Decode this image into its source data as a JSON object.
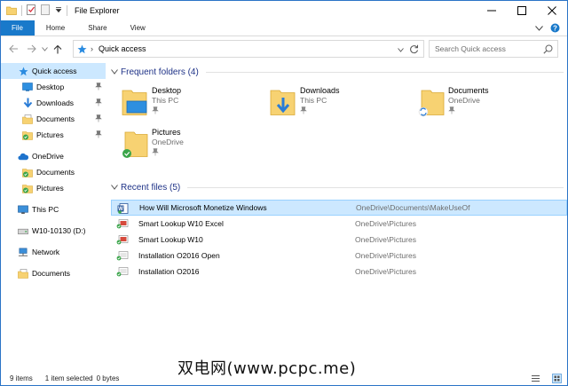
{
  "window": {
    "title": "File Explorer",
    "accent": "#1979ca",
    "selection_color": "#cce8ff"
  },
  "ribbon": {
    "tabs": [
      "File",
      "Home",
      "Share",
      "View"
    ]
  },
  "address": {
    "crumb": "Quick access",
    "crumb_separator": "›"
  },
  "search": {
    "placeholder": "Search Quick access"
  },
  "navpane": {
    "items": [
      {
        "label": "Quick access",
        "icon": "star-icon",
        "selected": true
      },
      {
        "label": "Desktop",
        "icon": "desktop-folder-icon",
        "pinned": true
      },
      {
        "label": "Downloads",
        "icon": "download-arrow-icon",
        "pinned": true
      },
      {
        "label": "Documents",
        "icon": "documents-folder-icon",
        "pinned": true
      },
      {
        "label": "Pictures",
        "icon": "pictures-folder-icon",
        "pinned": true
      },
      {
        "label": "OneDrive",
        "icon": "cloud-icon"
      },
      {
        "label": "Documents",
        "icon": "synced-folder-icon"
      },
      {
        "label": "Pictures",
        "icon": "synced-folder-icon"
      },
      {
        "label": "This PC",
        "icon": "computer-icon"
      },
      {
        "label": "W10-10130 (D:)",
        "icon": "drive-icon"
      },
      {
        "label": "Network",
        "icon": "network-icon"
      },
      {
        "label": "Documents",
        "icon": "documents-folder-icon"
      }
    ]
  },
  "frequent": {
    "heading": "Frequent folders (4)",
    "folders": [
      {
        "name": "Desktop",
        "location": "This PC",
        "icon": "desktop-folder-icon"
      },
      {
        "name": "Downloads",
        "location": "This PC",
        "icon": "downloads-folder-icon"
      },
      {
        "name": "Documents",
        "location": "OneDrive",
        "icon": "sync-folder-icon"
      },
      {
        "name": "Pictures",
        "location": "OneDrive",
        "icon": "synced-folder-icon"
      }
    ]
  },
  "recent": {
    "heading": "Recent files (5)",
    "files": [
      {
        "name": "How Will Microsoft Monetize Windows",
        "path": "OneDrive\\Documents\\MakeUseOf",
        "selected": true
      },
      {
        "name": "Smart Lookup W10 Excel",
        "path": "OneDrive\\Pictures"
      },
      {
        "name": "Smart Lookup W10",
        "path": "OneDrive\\Pictures"
      },
      {
        "name": "Installation O2016 Open",
        "path": "OneDrive\\Pictures"
      },
      {
        "name": "Installation O2016",
        "path": "OneDrive\\Pictures"
      }
    ]
  },
  "status": {
    "items": "9 items",
    "selected": "1 item selected",
    "size": "0 bytes"
  },
  "watermark": "双电网(www.pcpc.me)"
}
